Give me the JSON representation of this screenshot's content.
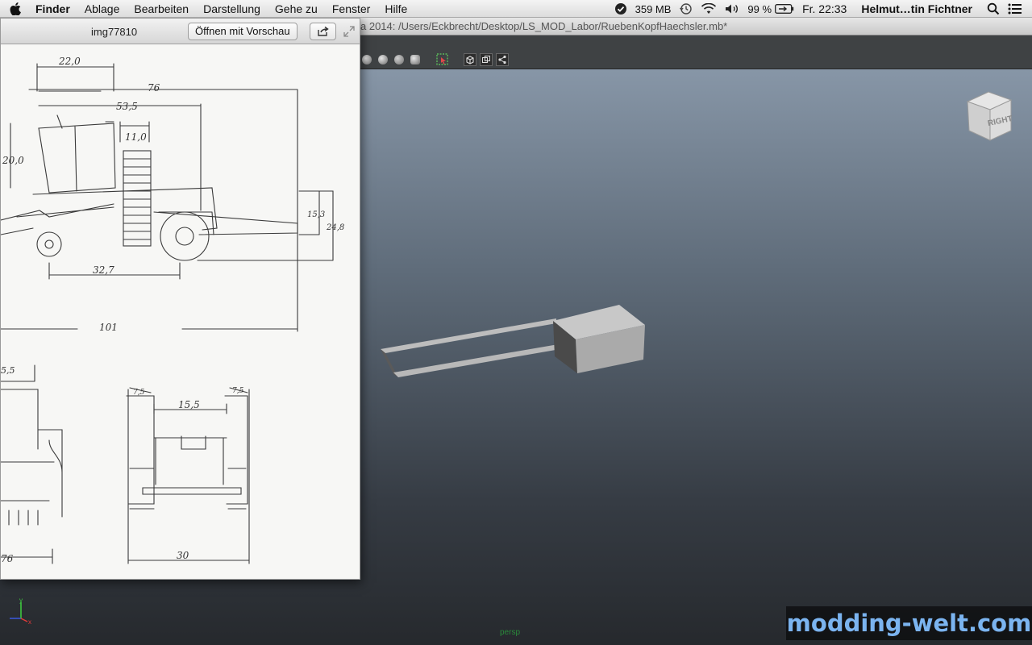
{
  "menubar": {
    "app_name": "Finder",
    "items": [
      "Ablage",
      "Bearbeiten",
      "Darstellung",
      "Gehe zu",
      "Fenster",
      "Hilfe"
    ],
    "status": {
      "memory": "359 MB",
      "battery": "99 %",
      "clock": "Fr. 22:33",
      "user": "Helmut…tin Fichtner"
    }
  },
  "maya": {
    "title": "a 2014: /Users/Eckbrecht/Desktop/LS_MOD_Labor/RuebenKopfHaechsler.mb*",
    "viewcube_label": "RIGHT",
    "camera_label": "persp",
    "axis_labels": {
      "x": "x",
      "y": "y"
    }
  },
  "quicklook": {
    "filename": "img77810",
    "open_button": "Öffnen mit Vorschau",
    "drawing_labels": {
      "d1": "22,0",
      "d2": "76",
      "d3": "53,5",
      "d4": "11,0",
      "d5": "20,0",
      "d6": "15,3",
      "d7": "24,8",
      "d8": "32,7",
      "d9": "101",
      "d10": "5,5",
      "d11": "7,5",
      "d12": "15,5",
      "d13": "7,5",
      "d14": "30",
      "d15": "76"
    }
  },
  "watermark": "modding-welt.com",
  "colors": {
    "viewport_top": "#8796a7",
    "viewport_bottom": "#26292d",
    "watermark": "#7bb4f0"
  }
}
